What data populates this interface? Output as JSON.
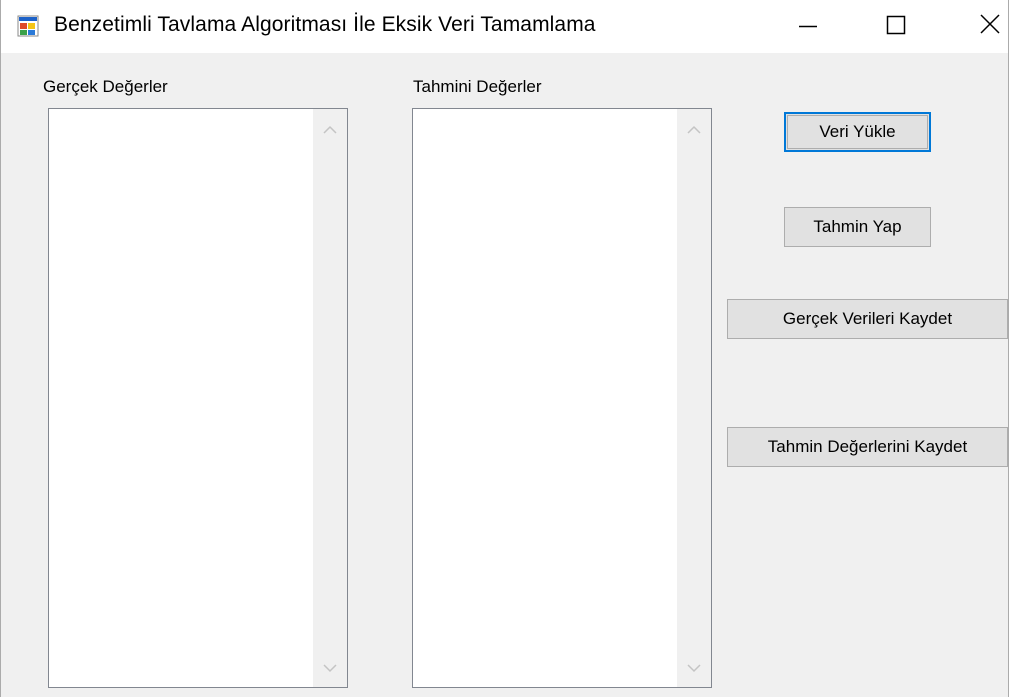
{
  "window": {
    "title": "Benzetimli Tavlama Algoritması İle  Eksik Veri Tamamlama",
    "icon": "form-app-icon",
    "controls": {
      "minimize_icon": "minimize-icon",
      "maximize_icon": "maximize-icon",
      "close_icon": "close-icon"
    }
  },
  "real_values": {
    "label": "Gerçek Değerler",
    "items": []
  },
  "predicted_values": {
    "label": "Tahmini Değerler",
    "items": []
  },
  "buttons": {
    "load_data": "Veri Yükle",
    "predict": "Tahmin Yap",
    "save_real": "Gerçek Verileri Kaydet",
    "save_predicted": "Tahmin Değerlerini Kaydet"
  },
  "colors": {
    "window_bg": "#f0f0f0",
    "titlebar_bg": "#ffffff",
    "button_bg": "#e1e1e1",
    "focus_accent": "#0078d7",
    "listbox_border": "#828790"
  }
}
